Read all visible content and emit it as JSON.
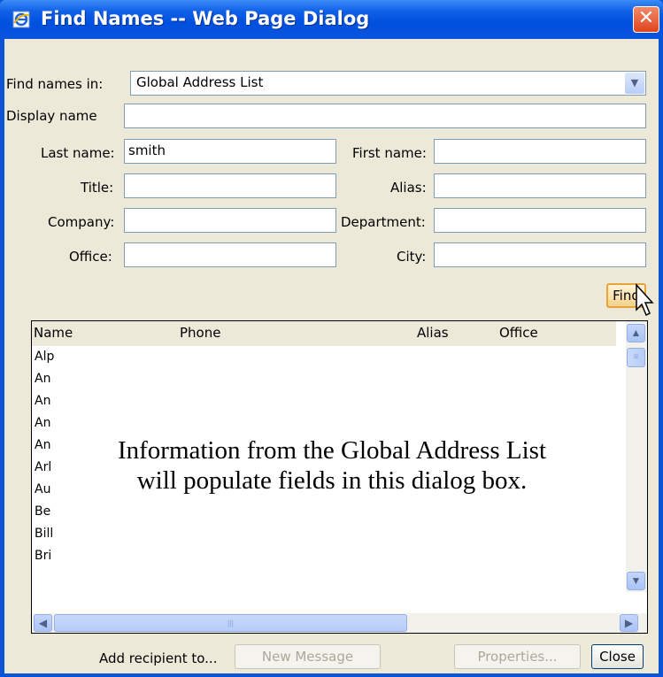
{
  "window": {
    "title": "Find Names -- Web Page Dialog",
    "close_glyph": "✕"
  },
  "form": {
    "find_names_in": {
      "label": "Find names in:",
      "value": "Global Address List"
    },
    "display_name": {
      "label": "Display name",
      "value": ""
    },
    "last_name": {
      "label": "Last name:",
      "value": "smith"
    },
    "first_name": {
      "label": "First name:",
      "value": ""
    },
    "title": {
      "label": "Title:",
      "value": ""
    },
    "alias": {
      "label": "Alias:",
      "value": ""
    },
    "company": {
      "label": "Company:",
      "value": ""
    },
    "department": {
      "label": "Department:",
      "value": ""
    },
    "office": {
      "label": "Office:",
      "value": ""
    },
    "city": {
      "label": "City:",
      "value": ""
    },
    "find_button": "Find"
  },
  "results": {
    "columns": [
      "Name",
      "Phone",
      "Alias",
      "Office"
    ],
    "rows": [
      "Alp",
      "An",
      "An",
      "An",
      "An",
      "Arl",
      "Au",
      "Be",
      "Bill",
      "Bri"
    ],
    "overlay_text": [
      "Information from the Global Address List",
      "will populate fields in this dialog box."
    ]
  },
  "footer": {
    "add_recipient_label": "Add recipient to...",
    "new_message_button": "New Message",
    "properties_button": "Properties...",
    "close_button": "Close"
  },
  "colors": {
    "titlebar": "#0054e3",
    "client": "#ece9d8",
    "find_highlight": "#e8a33a"
  }
}
